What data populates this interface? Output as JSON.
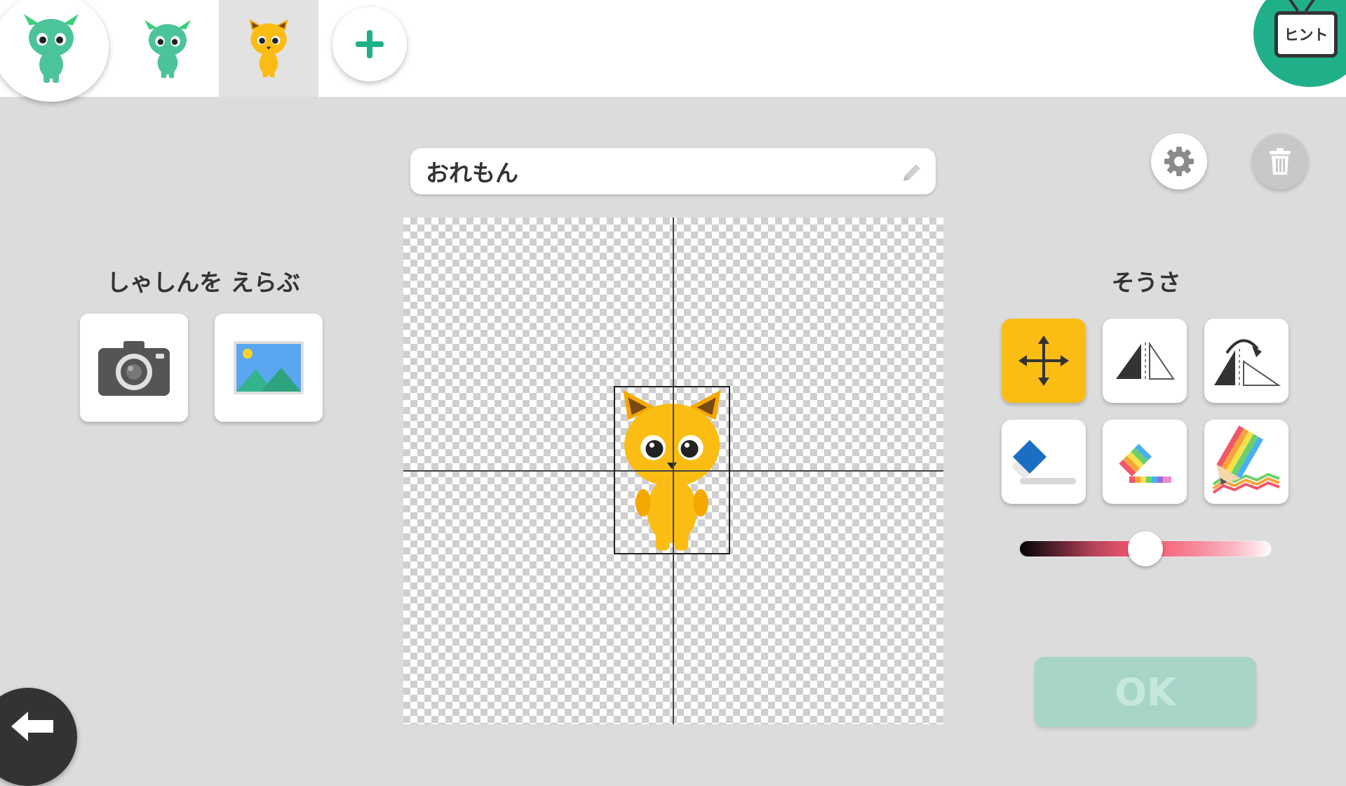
{
  "tabs": {
    "main_character": "green-monster",
    "items": [
      {
        "character": "green-monster",
        "selected": false
      },
      {
        "character": "orange-cat",
        "selected": true
      }
    ],
    "add_icon": "plus-icon"
  },
  "hint": {
    "label": "ヒント"
  },
  "name_field": {
    "value": "おれもん",
    "icon": "pencil-icon"
  },
  "photo_section": {
    "label": "しゃしんを えらぶ",
    "buttons": [
      {
        "icon": "camera-icon"
      },
      {
        "icon": "image-gallery-icon"
      }
    ]
  },
  "tools_section": {
    "label": "そうさ",
    "tools": [
      {
        "icon": "move-icon",
        "active": true
      },
      {
        "icon": "flip-icon",
        "active": false
      },
      {
        "icon": "rotate-flip-icon",
        "active": false
      },
      {
        "icon": "eraser-icon",
        "active": false
      },
      {
        "icon": "rainbow-eraser-icon",
        "active": false
      },
      {
        "icon": "rainbow-pencil-icon",
        "active": false
      }
    ]
  },
  "color_slider": {
    "value": 0.5
  },
  "header_icons": {
    "settings": "gear-icon",
    "delete": "trash-icon"
  },
  "ok_button": {
    "label": "OK",
    "enabled": false
  },
  "back_button": {
    "icon": "back-arrow-icon"
  },
  "colors": {
    "accent": "#1fb08a",
    "active_tool": "#fbbd14",
    "ok_disabled": "#a7d5c8"
  }
}
